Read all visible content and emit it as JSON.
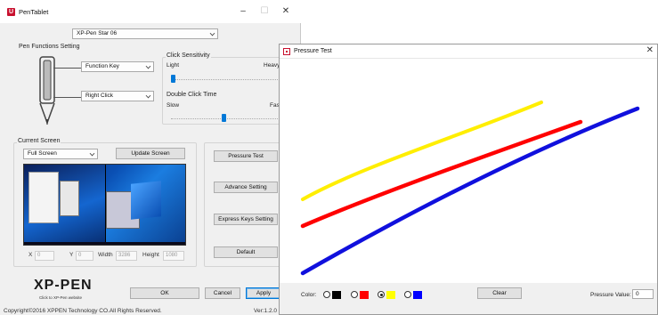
{
  "main_window": {
    "title": "PenTablet",
    "device_select": "XP-Pen Star 06",
    "pen_functions": {
      "group_label": "Pen Functions Setting",
      "upper_button": "Function Key",
      "lower_button": "Right Click"
    },
    "click_sensitivity": {
      "label": "Click Sensitivity",
      "min_label": "Light",
      "max_label": "Heavy",
      "level": 0.0
    },
    "double_click_time": {
      "label": "Double Click Time",
      "min_label": "Slow",
      "max_label": "Fast",
      "level": 0.5
    },
    "current_screen": {
      "group_label": "Current Screen",
      "mode": "Full Screen",
      "update_button": "Update Screen",
      "x_label": "X",
      "x_value": "0",
      "y_label": "Y",
      "y_value": "0",
      "width_label": "Width",
      "width_value": "3286",
      "height_label": "Height",
      "height_value": "1080"
    },
    "side_buttons": {
      "pressure_test": "Pressure Test",
      "advance_setting": "Advance Setting",
      "express_keys": "Express Keys Setting",
      "default": "Default"
    },
    "logo": {
      "brand": "XP-PEN",
      "link_text": "Click to XP-Pen website"
    },
    "dialog_buttons": {
      "ok": "OK",
      "cancel": "Cancel",
      "apply": "Apply"
    },
    "footer": {
      "copyright": "Copyright©2016 XPPEN Technology CO.All Rights Reserved.",
      "version": "Ver:1.2.0"
    },
    "window_controls": {
      "minimize": "–",
      "maximize": "☐",
      "close": "✕"
    }
  },
  "pressure_test": {
    "title": "Pressure Test",
    "close": "✕",
    "color_label": "Color:",
    "colors": [
      {
        "name": "black",
        "hex": "#000000",
        "selected": false
      },
      {
        "name": "red",
        "hex": "#ff0000",
        "selected": false
      },
      {
        "name": "yellow",
        "hex": "#ffff00",
        "selected": true
      },
      {
        "name": "blue",
        "hex": "#0000ff",
        "selected": false
      }
    ],
    "clear_button": "Clear",
    "pressure_value_label": "Pressure Value:",
    "pressure_value": "0",
    "strokes": [
      {
        "color": "#ffee00"
      },
      {
        "color": "#ff0000"
      },
      {
        "color": "#1010dd"
      }
    ]
  }
}
